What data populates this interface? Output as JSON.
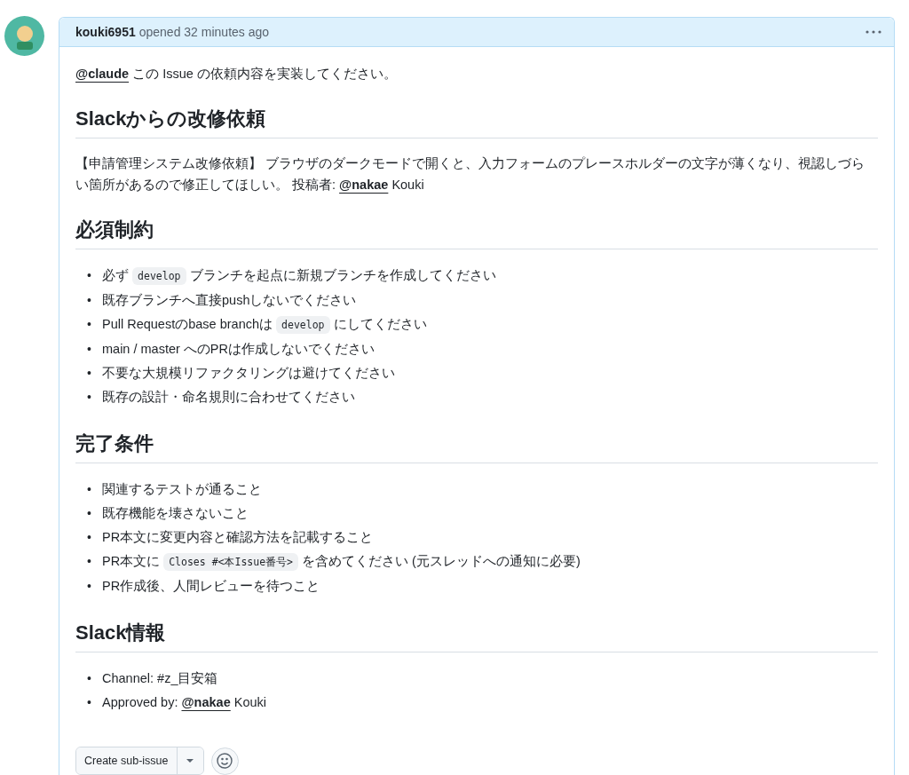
{
  "comment": {
    "author": "kouki6951",
    "action": "opened 32 minutes ago"
  },
  "body": [
    {
      "kind": "paragraph",
      "parts": [
        {
          "kind": "mention",
          "text": "@claude"
        },
        {
          "kind": "plain",
          "text": " この Issue の依頼内容を実装してください。"
        }
      ]
    },
    {
      "kind": "heading",
      "text": "Slackからの改修依頼"
    },
    {
      "kind": "paragraph",
      "parts": [
        {
          "kind": "plain",
          "text": "【申請管理システム改修依頼】 ブラウザのダークモードで開くと、入力フォームのプレースホルダーの文字が薄くなり、視認しづらい箇所があるので修正してほしい。 投稿者: "
        },
        {
          "kind": "mention",
          "text": "@nakae"
        },
        {
          "kind": "plain",
          "text": " Kouki"
        }
      ]
    },
    {
      "kind": "heading",
      "text": "必須制約"
    },
    {
      "kind": "list",
      "items": [
        {
          "marker": "•",
          "parts": [
            {
              "kind": "plain",
              "text": "必ず "
            },
            {
              "kind": "code",
              "text": "develop"
            },
            {
              "kind": "plain",
              "text": " ブランチを起点に新規ブランチを作成してください"
            }
          ]
        },
        {
          "marker": "•",
          "parts": [
            {
              "kind": "plain",
              "text": "既存ブランチへ直接pushしないでください"
            }
          ]
        },
        {
          "marker": "•",
          "parts": [
            {
              "kind": "plain",
              "text": "Pull Requestのbase branchは "
            },
            {
              "kind": "code",
              "text": "develop"
            },
            {
              "kind": "plain",
              "text": " にしてください"
            }
          ]
        },
        {
          "marker": "•",
          "parts": [
            {
              "kind": "plain",
              "text": "main / master へのPRは作成しないでください"
            }
          ]
        },
        {
          "marker": "•",
          "parts": [
            {
              "kind": "plain",
              "text": "不要な大規模リファクタリングは避けてください"
            }
          ]
        },
        {
          "marker": "•",
          "parts": [
            {
              "kind": "plain",
              "text": "既存の設計・命名規則に合わせてください"
            }
          ]
        }
      ]
    },
    {
      "kind": "heading",
      "text": "完了条件"
    },
    {
      "kind": "list",
      "items": [
        {
          "marker": "•",
          "parts": [
            {
              "kind": "plain",
              "text": "関連するテストが通ること"
            }
          ]
        },
        {
          "marker": "•",
          "parts": [
            {
              "kind": "plain",
              "text": "既存機能を壊さないこと"
            }
          ]
        },
        {
          "marker": "•",
          "parts": [
            {
              "kind": "plain",
              "text": "PR本文に変更内容と確認方法を記載すること"
            }
          ]
        },
        {
          "marker": "•",
          "parts": [
            {
              "kind": "plain",
              "text": "PR本文に "
            },
            {
              "kind": "code",
              "text": "Closes #<本Issue番号>"
            },
            {
              "kind": "plain",
              "text": " を含めてください (元スレッドへの通知に必要)"
            }
          ]
        },
        {
          "marker": "•",
          "parts": [
            {
              "kind": "plain",
              "text": "PR作成後、人間レビューを待つこと"
            }
          ]
        }
      ]
    },
    {
      "kind": "heading",
      "text": "Slack情報"
    },
    {
      "kind": "list",
      "items": [
        {
          "marker": "•",
          "parts": [
            {
              "kind": "plain",
              "text": "Channel: #z_目安箱"
            }
          ]
        },
        {
          "marker": "•",
          "parts": [
            {
              "kind": "plain",
              "text": "Approved by: "
            },
            {
              "kind": "mention",
              "text": "@nakae"
            },
            {
              "kind": "plain",
              "text": " Kouki"
            }
          ]
        }
      ]
    }
  ],
  "actions": {
    "create_button": "Create sub-issue"
  }
}
